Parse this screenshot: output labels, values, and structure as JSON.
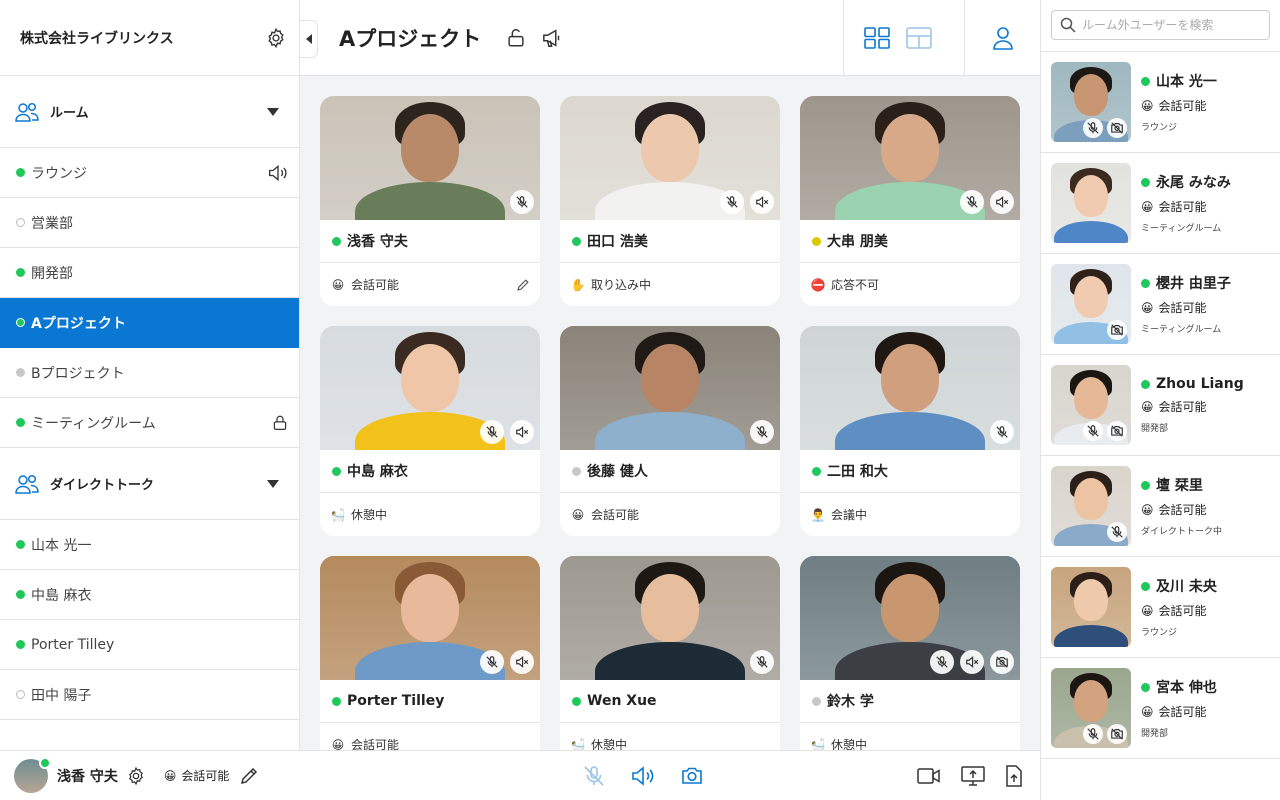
{
  "company": {
    "name": "株式会社ライブリンクス"
  },
  "sections": {
    "rooms": {
      "label": "ルーム"
    },
    "direct": {
      "label": "ダイレクトトーク"
    }
  },
  "rooms": [
    {
      "label": "ラウンジ",
      "status": "green",
      "icon": "speaker-icon"
    },
    {
      "label": "営業部",
      "status": "empty"
    },
    {
      "label": "開発部",
      "status": "green"
    },
    {
      "label": "Aプロジェクト",
      "status": "green",
      "active": true
    },
    {
      "label": "Bプロジェクト",
      "status": "gray"
    },
    {
      "label": "ミーティングルーム",
      "status": "green",
      "icon": "lock-icon"
    }
  ],
  "direct_talks": [
    {
      "label": "山本 光一",
      "status": "green"
    },
    {
      "label": "中島 麻衣",
      "status": "green"
    },
    {
      "label": "Porter Tilley",
      "status": "green"
    },
    {
      "label": "田中 陽子",
      "status": "empty"
    }
  ],
  "header": {
    "title": "Aプロジェクト"
  },
  "participants": [
    {
      "name": "浅香 守夫",
      "presence": "green",
      "emoji": "😀",
      "status": "会話可能",
      "editable": true,
      "muted": [
        "mic-off-icon"
      ],
      "bg": "#c9c3b8",
      "skin": "#b98a6a",
      "hair": "#2d241e",
      "shirt": "#6a7d5a"
    },
    {
      "name": "田口 浩美",
      "presence": "green",
      "emoji": "✋",
      "status": "取り込み中",
      "muted": [
        "mic-off-icon",
        "speaker-off-icon"
      ],
      "bg": "#dcd8d0",
      "skin": "#ecc9ad",
      "hair": "#2a2220",
      "shirt": "#f2f2f0"
    },
    {
      "name": "大串 朋美",
      "presence": "yellow",
      "emoji": "⛔",
      "status": "応答不可",
      "muted": [
        "mic-off-icon",
        "speaker-off-icon"
      ],
      "bg": "#9e968c",
      "skin": "#d7a988",
      "hair": "#2b2019",
      "shirt": "#9bd3b0"
    },
    {
      "name": "中島 麻衣",
      "presence": "green",
      "emoji": "🛀",
      "status": "休憩中",
      "muted": [
        "mic-off-icon",
        "speaker-off-icon"
      ],
      "bg": "#d6dbe0",
      "skin": "#efc7a8",
      "hair": "#3a2a22",
      "shirt": "#f2c11a"
    },
    {
      "name": "後藤 健人",
      "presence": "gray",
      "emoji": "😀",
      "status": "会話可能",
      "muted": [
        "mic-off-icon"
      ],
      "bg": "#8a847a",
      "skin": "#b88466",
      "hair": "#1f1a16",
      "shirt": "#8fb0cc"
    },
    {
      "name": "二田 和大",
      "presence": "green",
      "emoji": "👨‍💼",
      "status": "会議中",
      "muted": [
        "mic-off-icon"
      ],
      "bg": "#cfd5d6",
      "skin": "#cf9f7e",
      "hair": "#1e1712",
      "shirt": "#5f8fc2"
    },
    {
      "name": "Porter Tilley",
      "presence": "green",
      "emoji": "😀",
      "status": "会話可能",
      "muted": [
        "mic-off-icon",
        "speaker-off-icon"
      ],
      "bg": "#b58a5e",
      "skin": "#e8b99a",
      "hair": "#8a5a36",
      "shirt": "#6e9ac7"
    },
    {
      "name": "Wen Xue",
      "presence": "green",
      "emoji": "🛀",
      "status": "休憩中",
      "muted": [
        "mic-off-icon"
      ],
      "bg": "#9d9890",
      "skin": "#e6be9e",
      "hair": "#1e1814",
      "shirt": "#1e2a35"
    },
    {
      "name": "鈴木 学",
      "presence": "gray",
      "emoji": "🛀",
      "status": "休憩中",
      "muted": [
        "mic-off-icon",
        "speaker-off-icon",
        "camera-off-icon"
      ],
      "bg": "#6f7e83",
      "skin": "#c8966f",
      "hair": "#1b1612",
      "shirt": "#3b3f44"
    }
  ],
  "right_panel": {
    "search_placeholder": "ルーム外ユーザーを検索",
    "users": [
      {
        "name": "山本 光一",
        "emoji": "😀",
        "status": "会話可能",
        "location": "ラウンジ",
        "muted": [
          "mic-off-icon",
          "camera-off-icon"
        ],
        "bg": "#9fb7bf",
        "skin": "#c89673",
        "hair": "#1d1814",
        "shirt": "#7d9fbe"
      },
      {
        "name": "永尾 みなみ",
        "emoji": "😀",
        "status": "会話可能",
        "location": "ミーティングルーム",
        "muted": [],
        "bg": "#e2e2de",
        "skin": "#f0cbb0",
        "hair": "#3a2a20",
        "shirt": "#4f86c7"
      },
      {
        "name": "櫻井 由里子",
        "emoji": "😀",
        "status": "会話可能",
        "location": "ミーティングルーム",
        "muted": [
          "camera-off-icon"
        ],
        "bg": "#dfe5ea",
        "skin": "#f0cbb0",
        "hair": "#2e2119",
        "shirt": "#92c0e4"
      },
      {
        "name": "Zhou Liang",
        "emoji": "😀",
        "status": "会話可能",
        "location": "開発部",
        "muted": [
          "mic-off-icon",
          "camera-off-icon"
        ],
        "bg": "#d8d4ce",
        "skin": "#e5b897",
        "hair": "#1b1612",
        "shirt": "#e9ecef"
      },
      {
        "name": "壇 栞里",
        "emoji": "😀",
        "status": "会話可能",
        "location": "ダイレクトトーク中",
        "muted": [
          "mic-off-icon"
        ],
        "bg": "#d9d4cc",
        "skin": "#ecc3a3",
        "hair": "#2a1f19",
        "shirt": "#8ba9c8"
      },
      {
        "name": "及川 未央",
        "emoji": "😀",
        "status": "会話可能",
        "location": "ラウンジ",
        "muted": [],
        "bg": "#c7a57e",
        "skin": "#efc9ab",
        "hair": "#2b1f18",
        "shirt": "#2d4f7a"
      },
      {
        "name": "宮本 伸也",
        "emoji": "😀",
        "status": "会話可能",
        "location": "開発部",
        "muted": [
          "mic-off-icon",
          "camera-off-icon"
        ],
        "bg": "#9aa68e",
        "skin": "#d3a27f",
        "hair": "#1b1612",
        "shirt": "#c9c0ae"
      }
    ]
  },
  "bottom": {
    "name": "浅香 守夫",
    "emoji": "😀",
    "status": "会話可能"
  },
  "colors": {
    "accent": "#0a78d2",
    "green": "#1ec85a",
    "gray": "#c8c8c8",
    "yellow": "#dcc800"
  }
}
